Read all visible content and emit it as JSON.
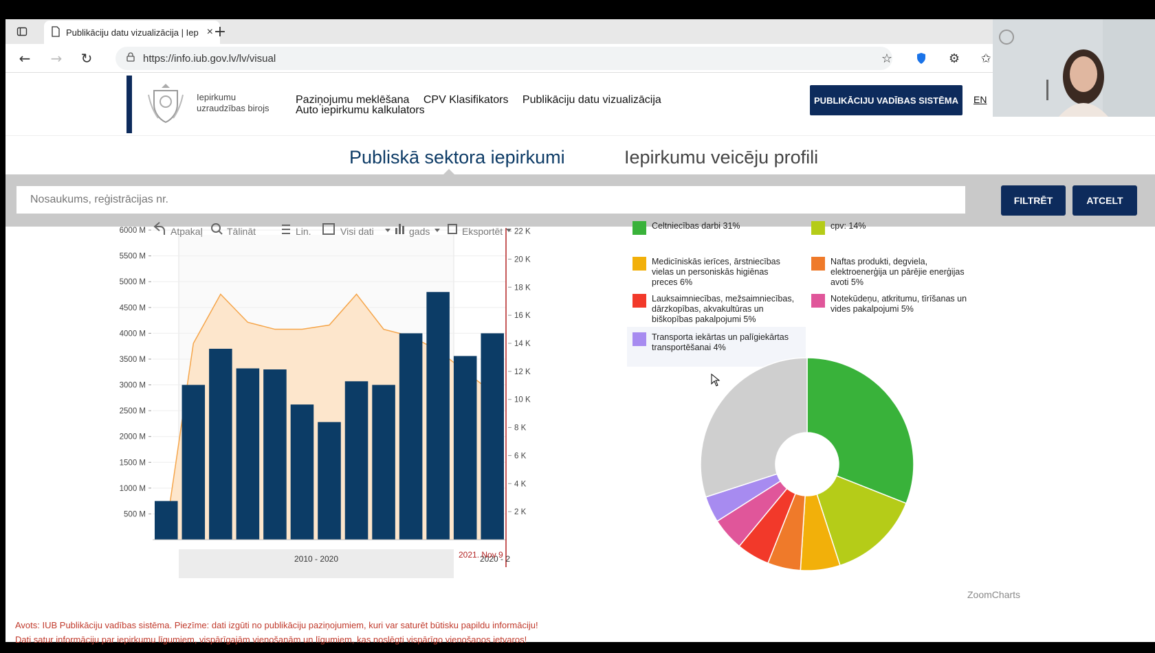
{
  "browser": {
    "tab_title": "Publikāciju datu vizualizācija | Iep",
    "url": "https://info.iub.gov.lv/lv/visual"
  },
  "site": {
    "logo_line1": "Iepirkumu",
    "logo_line2": "uzraudzības birojs",
    "nav": [
      "Paziņojumu meklēšana",
      "CPV Klasifikators",
      "Publikāciju datu vizualizācija",
      "Auto iepirkumu kalkulators"
    ],
    "pvs_button": "PUBLIKĀCIJU VADĪBAS SISTĒMA",
    "lang": "EN"
  },
  "tabs": {
    "public": "Publiskā sektora iepirkumi",
    "profiles": "Iepirkumu veicēju profili"
  },
  "search": {
    "placeholder": "Nosaukums, reģistrācijas nr.",
    "filter_label": "FILTRĒT",
    "cancel_label": "ATCELT"
  },
  "toolbar": {
    "back": "Atpakaļ",
    "zoom": "Tālināt",
    "lin": "Lin.",
    "all_data": "Visi dati",
    "period": "gads",
    "export": "Eksportēt"
  },
  "chart_data": [
    {
      "type": "bar",
      "x_labels": [
        "2010 - 2020",
        "2020 - 2"
      ],
      "cursor_label": "2021. Nov 9",
      "left_axis": {
        "ticks": [
          "500 M",
          "1000 M",
          "1500 M",
          "2000 M",
          "2500 M",
          "3000 M",
          "3500 M",
          "4000 M",
          "4500 M",
          "5000 M",
          "5500 M",
          "6000 M"
        ],
        "ylim": [
          0,
          6000
        ]
      },
      "right_axis": {
        "ticks": [
          "2 K",
          "4 K",
          "6 K",
          "8 K",
          "10 K",
          "12 K",
          "14 K",
          "16 K",
          "18 K",
          "20 K",
          "22 K"
        ],
        "ylim": [
          0,
          22000
        ]
      },
      "series": [
        {
          "values": [
            750,
            3000,
            3700,
            3320,
            3300,
            2620,
            2280,
            3070,
            3000,
            4000,
            4800,
            3560,
            4000
          ],
          "color": "#0c3c66"
        },
        {
          "values": [
            800,
            14000,
            17500,
            15500,
            15000,
            15000,
            15300,
            17500,
            15000,
            14500,
            13500,
            12000,
            10500
          ],
          "color": "#f5a54a"
        }
      ]
    },
    {
      "type": "pie",
      "slices": [
        {
          "label": "Celtniecības darbi 31%",
          "value": 31,
          "color": "#39b23a"
        },
        {
          "label": "cpv: 14%",
          "value": 14,
          "color": "#b5cc18"
        },
        {
          "label": "Medicīniskās ierīces, ārstniecības vielas un personiskās higiēnas preces 6%",
          "value": 6,
          "color": "#f2b00a"
        },
        {
          "label": "Naftas produkti, degviela, elektroenerģija un pārējie enerģijas avoti 5%",
          "value": 5,
          "color": "#ef7a2a"
        },
        {
          "label": "Lauksaimniecības, mežsaimniecības, dārzkopības, akvakultūras un biškopības pakalpojumi 5%",
          "value": 5,
          "color": "#f2392a"
        },
        {
          "label": "Notekūdeņu, atkritumu, tīrīšanas un vides pakalpojumi 5%",
          "value": 5,
          "color": "#e0569a"
        },
        {
          "label": "Transporta iekārtas un palīgiekārtas transportēšanai 4%",
          "value": 4,
          "color": "#a78bf0"
        },
        {
          "label": "",
          "value": 30,
          "color": "#cfcfcf"
        }
      ]
    }
  ],
  "zoomcharts": "ZoomCharts",
  "footnotes": {
    "line1": "Avots: IUB Publikāciju vadības sistēma. Piezīme: dati izgūti no publikāciju paziņojumiem, kuri var saturēt būtisku papildu informāciju!",
    "line2": "Dati satur informāciju par iepirkumu līgumiem, vispārīgajām vienošanām un līgumiem, kas noslēgti vispārīgo vienošanos ietvaros!"
  }
}
